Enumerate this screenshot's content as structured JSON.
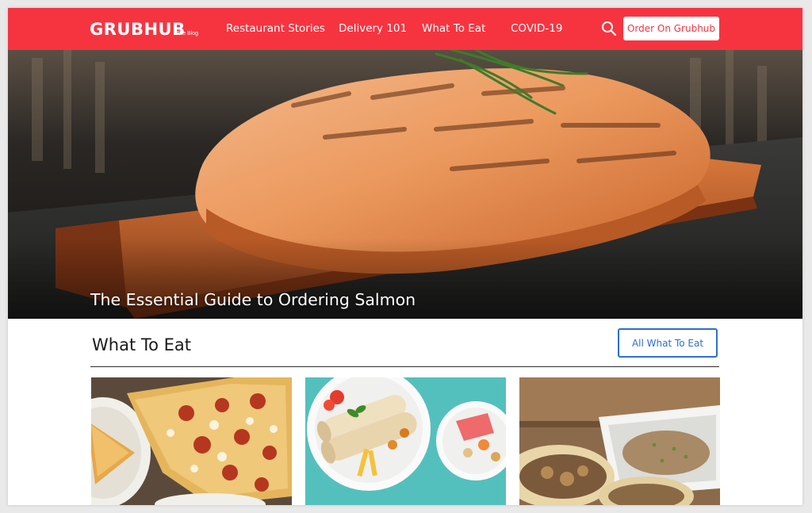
{
  "nav": {
    "logo": "GRUBHUB",
    "logo_sub": "The Blog",
    "links": [
      "Restaurant Stories",
      "Delivery 101",
      "What To Eat",
      "COVID-19"
    ],
    "search_icon": "search-icon",
    "order_button": "Order On Grubhub"
  },
  "hero": {
    "title": "The Essential Guide to Ordering Salmon"
  },
  "section": {
    "title": "What To Eat",
    "all_button": "All What To Eat"
  },
  "colors": {
    "brand_red": "#f63440",
    "link_blue": "#2d6fd0"
  }
}
